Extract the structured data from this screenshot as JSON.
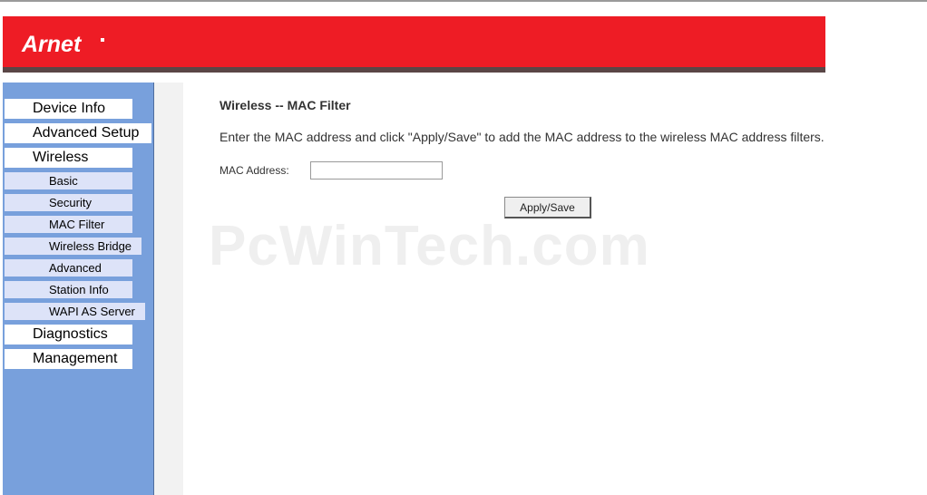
{
  "brand": {
    "logo_text": "Arnet"
  },
  "sidebar": {
    "items": [
      {
        "label": "Device Info"
      },
      {
        "label": "Advanced Setup"
      },
      {
        "label": "Wireless"
      },
      {
        "label": "Diagnostics"
      },
      {
        "label": "Management"
      }
    ],
    "wireless_sub": [
      {
        "label": "Basic"
      },
      {
        "label": "Security"
      },
      {
        "label": "MAC Filter"
      },
      {
        "label": "Wireless Bridge"
      },
      {
        "label": "Advanced"
      },
      {
        "label": "Station Info"
      },
      {
        "label": "WAPI AS Server"
      }
    ]
  },
  "main": {
    "title": "Wireless -- MAC Filter",
    "instructions": "Enter the MAC address and click \"Apply/Save\" to add the MAC address to the wireless MAC address filters.",
    "mac_label": "MAC Address:",
    "mac_value": "",
    "apply_label": "Apply/Save"
  },
  "watermark": "PcWinTech.com",
  "colors": {
    "header_red": "#ee1c25",
    "sidebar_blue": "#78a0dc",
    "submenu_bg": "#dde3f8"
  }
}
